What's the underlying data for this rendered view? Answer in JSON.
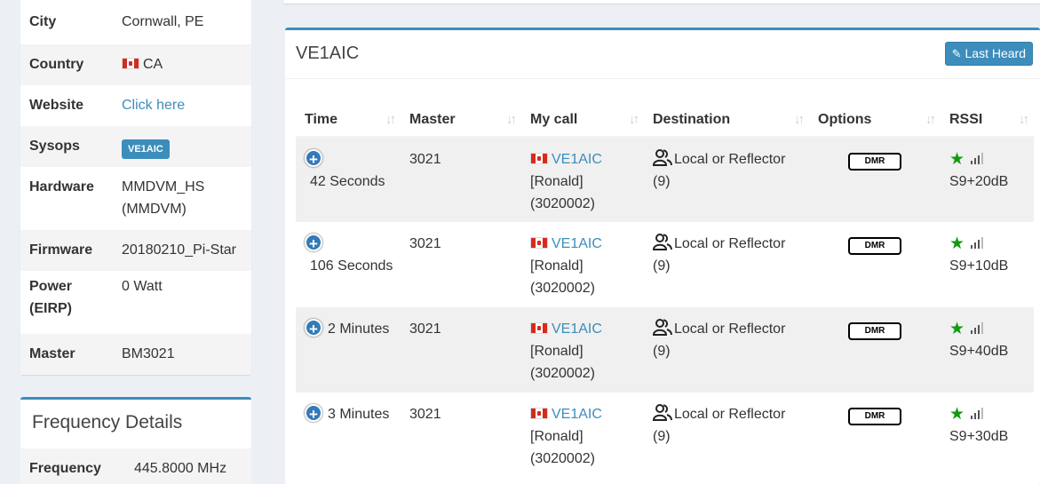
{
  "station_info": {
    "rows": [
      {
        "label": "City",
        "value": "Cornwall, PE"
      },
      {
        "label": "Country",
        "value": "CA"
      },
      {
        "label": "Website",
        "value": "Click here"
      },
      {
        "label": "Sysops",
        "value": "VE1AIC"
      },
      {
        "label": "Hardware",
        "value": "MMDVM_HS (MMDVM)"
      },
      {
        "label": "Firmware",
        "value": "20180210_Pi-Star"
      },
      {
        "label": "Power (EIRP)",
        "value": "0 Watt"
      },
      {
        "label": "Master",
        "value": "BM3021"
      }
    ]
  },
  "frequency_details": {
    "title": "Frequency Details",
    "label": "Frequency",
    "value": "445.8000 MHz"
  },
  "last_heard": {
    "title": "VE1AIC",
    "button_label": "Last Heard",
    "columns": [
      "Time",
      "Master",
      "My call",
      "Destination",
      "Options",
      "RSSI"
    ],
    "rows": [
      {
        "time": "42 Seconds",
        "master": "3021",
        "call": "VE1AIC",
        "name": "[Ronald]",
        "id": "(3020002)",
        "destination": "Local or Reflector",
        "dest_count": "(9)",
        "option": "DMR",
        "rssi": "S9+20dB"
      },
      {
        "time": "106 Seconds",
        "master": "3021",
        "call": "VE1AIC",
        "name": "[Ronald]",
        "id": "(3020002)",
        "destination": "Local or Reflector",
        "dest_count": "(9)",
        "option": "DMR",
        "rssi": "S9+10dB"
      },
      {
        "time": "2 Minutes",
        "master": "3021",
        "call": "VE1AIC",
        "name": "[Ronald]",
        "id": "(3020002)",
        "destination": "Local or Reflector",
        "dest_count": "(9)",
        "option": "DMR",
        "rssi": "S9+40dB"
      },
      {
        "time": "3 Minutes",
        "master": "3021",
        "call": "VE1AIC",
        "name": "[Ronald]",
        "id": "(3020002)",
        "destination": "Local or Reflector",
        "dest_count": "(9)",
        "option": "DMR",
        "rssi": "S9+30dB"
      }
    ]
  },
  "icons": {
    "edit": "edit-icon",
    "sort": "sort-icon",
    "expand": "plus-circle-icon",
    "group": "group-icon",
    "star": "star-icon",
    "signal": "signal-bars-icon",
    "flag": "canada-flag-icon"
  },
  "colors": {
    "accent": "#3c8dbc",
    "star": "#119b11"
  }
}
